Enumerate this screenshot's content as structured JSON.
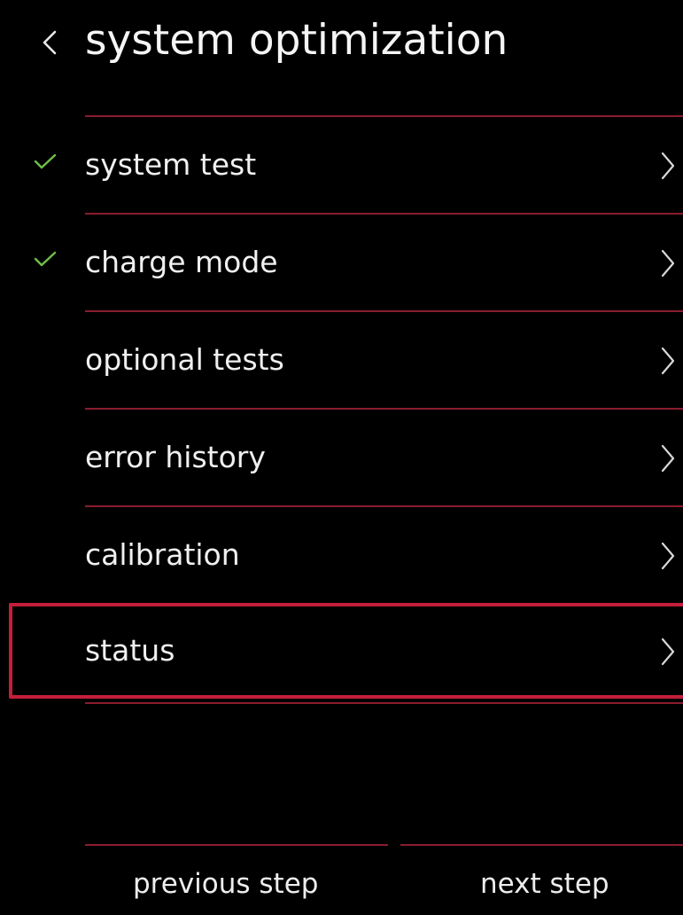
{
  "header": {
    "title": "system optimization",
    "back_icon": "chevron-left-icon"
  },
  "colors": {
    "background": "#000000",
    "divider": "#8a1c2e",
    "selection_border": "#c41e3a",
    "check": "#6fbf4a",
    "text": "#f0f0f0"
  },
  "menu": {
    "items": [
      {
        "label": "system test",
        "checked": true,
        "icon": "chevron-right-icon"
      },
      {
        "label": "charge mode",
        "checked": true,
        "icon": "chevron-right-icon"
      },
      {
        "label": "optional tests",
        "checked": false,
        "icon": "chevron-right-icon"
      },
      {
        "label": "error history",
        "checked": false,
        "icon": "chevron-right-icon"
      },
      {
        "label": "calibration",
        "checked": false,
        "icon": "chevron-right-icon"
      },
      {
        "label": "status",
        "checked": false,
        "selected": true,
        "icon": "chevron-right-icon"
      }
    ]
  },
  "footer": {
    "previous_label": "previous step",
    "next_label": "next step"
  }
}
